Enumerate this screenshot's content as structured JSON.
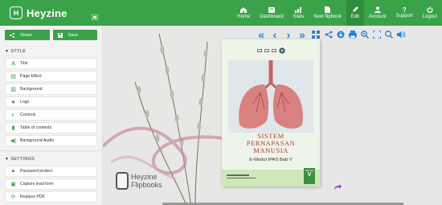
{
  "brand": {
    "name": "Heyzine"
  },
  "nav": [
    {
      "label": "Home",
      "icon": "home-icon"
    },
    {
      "label": "Dashboard",
      "icon": "dashboard-icon"
    },
    {
      "label": "Stats",
      "icon": "stats-icon"
    },
    {
      "label": "New flipbook",
      "icon": "new-file-icon"
    },
    {
      "label": "Edit",
      "icon": "pencil-icon",
      "active": true
    },
    {
      "label": "Account",
      "icon": "user-icon"
    },
    {
      "label": "Support",
      "icon": "question-icon"
    },
    {
      "label": "Logout",
      "icon": "power-icon"
    }
  ],
  "sidebar": {
    "share_label": "Share",
    "save_label": "Save",
    "style_header": "STYLE",
    "style_items": [
      {
        "label": "Title",
        "icon": "title-icon"
      },
      {
        "label": "Page Effect",
        "icon": "page-effect-icon"
      },
      {
        "label": "Background",
        "icon": "image-icon"
      },
      {
        "label": "Logo",
        "icon": "star-icon"
      },
      {
        "label": "Controls",
        "icon": "toggle-icon"
      },
      {
        "label": "Table of contents",
        "icon": "bookmark-icon"
      },
      {
        "label": "Background Audio",
        "icon": "speaker-icon"
      }
    ],
    "settings_header": "SETTINGS",
    "settings_items": [
      {
        "label": "Password protect",
        "icon": "lock-icon"
      },
      {
        "label": "Capture lead form",
        "icon": "form-icon"
      },
      {
        "label": "Replace PDF",
        "icon": "refresh-icon"
      }
    ]
  },
  "book": {
    "title_line1": "SISTEM",
    "title_line2": "PERNAPASAN",
    "title_line3": "MANUSIA",
    "subtitle": "E-Modul IPAS Bab V",
    "kelas": "KELAS",
    "kelas_num": "V"
  },
  "overlay_logo": {
    "line1": "Heyzine",
    "line2": "Flipbooks"
  },
  "colors": {
    "accent": "#3aa34a",
    "toolbar_icon": "#2f7fd9",
    "title": "#b23b3b"
  }
}
